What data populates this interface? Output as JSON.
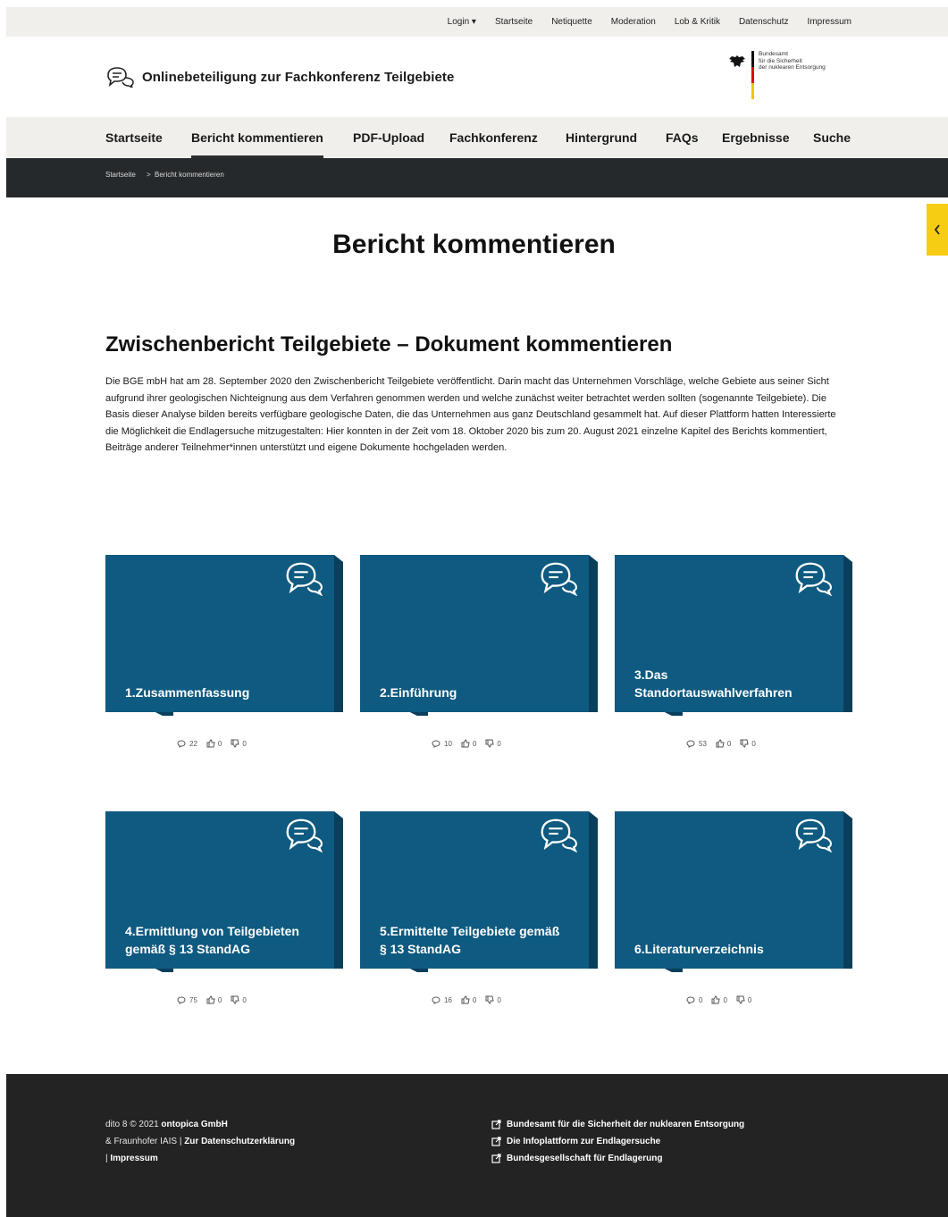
{
  "topbar": {
    "links": [
      "Login",
      "Startseite",
      "Netiquette",
      "Moderation",
      "Lob & Kritik",
      "Datenschutz",
      "Impressum"
    ]
  },
  "header": {
    "title": "Onlinebeteiligung zur Fachkonferenz Teilgebiete",
    "logo_text": "Bundesamt\nfür die Sicherheit\nder nuklearen Entsorgung"
  },
  "nav": {
    "items": [
      "Startseite",
      "Bericht kommentieren",
      "PDF-Upload",
      "Fachkonferenz",
      "Hintergrund",
      "FAQs",
      "Ergebnisse",
      "Suche"
    ],
    "active": "Bericht kommentieren"
  },
  "breadcrumb": {
    "home": "Startseite",
    "separator": ">",
    "current": "Bericht kommentieren"
  },
  "page": {
    "title": "Bericht kommentieren",
    "section_title": "Zwischenbericht Teilgebiete – Dokument kommentieren",
    "intro": "Die BGE mbH hat am 28. September 2020 den Zwischenbericht Teilgebiete veröffentlicht. Darin macht das Unternehmen Vorschläge, welche Gebiete aus seiner Sicht aufgrund ihrer geologischen Nichteignung aus dem Verfahren genommen werden und welche zunächst weiter betrachtet werden sollten (sogenannte Teilgebiete). Die Basis dieser Analyse bilden bereits verfügbare geologische Daten, die das Unternehmen aus ganz Deutschland gesammelt hat. Auf dieser Plattform hatten Interessierte die Möglichkeit die Endlagersuche mitzugestalten: Hier konnten in der Zeit vom 18. Oktober 2020 bis zum 20. August 2021 einzelne Kapitel des Berichts kommentiert, Beiträge anderer Teilnehmer*innen unterstützt und eigene Dokumente hochgeladen werden."
  },
  "cards": [
    {
      "title": "1.Zusammenfassung",
      "comments": "22",
      "likes": "0",
      "dislikes": "0"
    },
    {
      "title": "2.Einführung",
      "comments": "10",
      "likes": "0",
      "dislikes": "0"
    },
    {
      "title": "3.Das Standortauswahlverfahren",
      "comments": "53",
      "likes": "0",
      "dislikes": "0"
    },
    {
      "title": "4.Ermittlung von Teilgebieten gemäß § 13 StandAG",
      "comments": "75",
      "likes": "0",
      "dislikes": "0"
    },
    {
      "title": "5.Ermittelte Teilgebiete gemäß § 13 StandAG",
      "comments": "16",
      "likes": "0",
      "dislikes": "0"
    },
    {
      "title": "6.Literaturverzeichnis",
      "comments": "0",
      "likes": "0",
      "dislikes": "0"
    }
  ],
  "footer": {
    "line1_prefix": "dito 8 © 2021 ",
    "line1_bold": "ontopica GmbH",
    "line2_prefix": "& Fraunhofer IAIS | ",
    "line2_bold": "Zur Datenschutzerklärung",
    "line3_prefix": "| ",
    "line3_bold": "Impressum",
    "links": [
      "Bundesamt für die Sicherheit der nuklearen Entsorgung",
      "Die Infoplattform zur Endlagersuche",
      "Bundesgesellschaft für Endlagerung"
    ]
  },
  "colors": {
    "card": "#0f5a80",
    "card_shadow": "#0a3f5c",
    "accent_tab": "#f7cd14",
    "breadcrumb_bg": "#26292b",
    "footer_bg": "#232323"
  }
}
